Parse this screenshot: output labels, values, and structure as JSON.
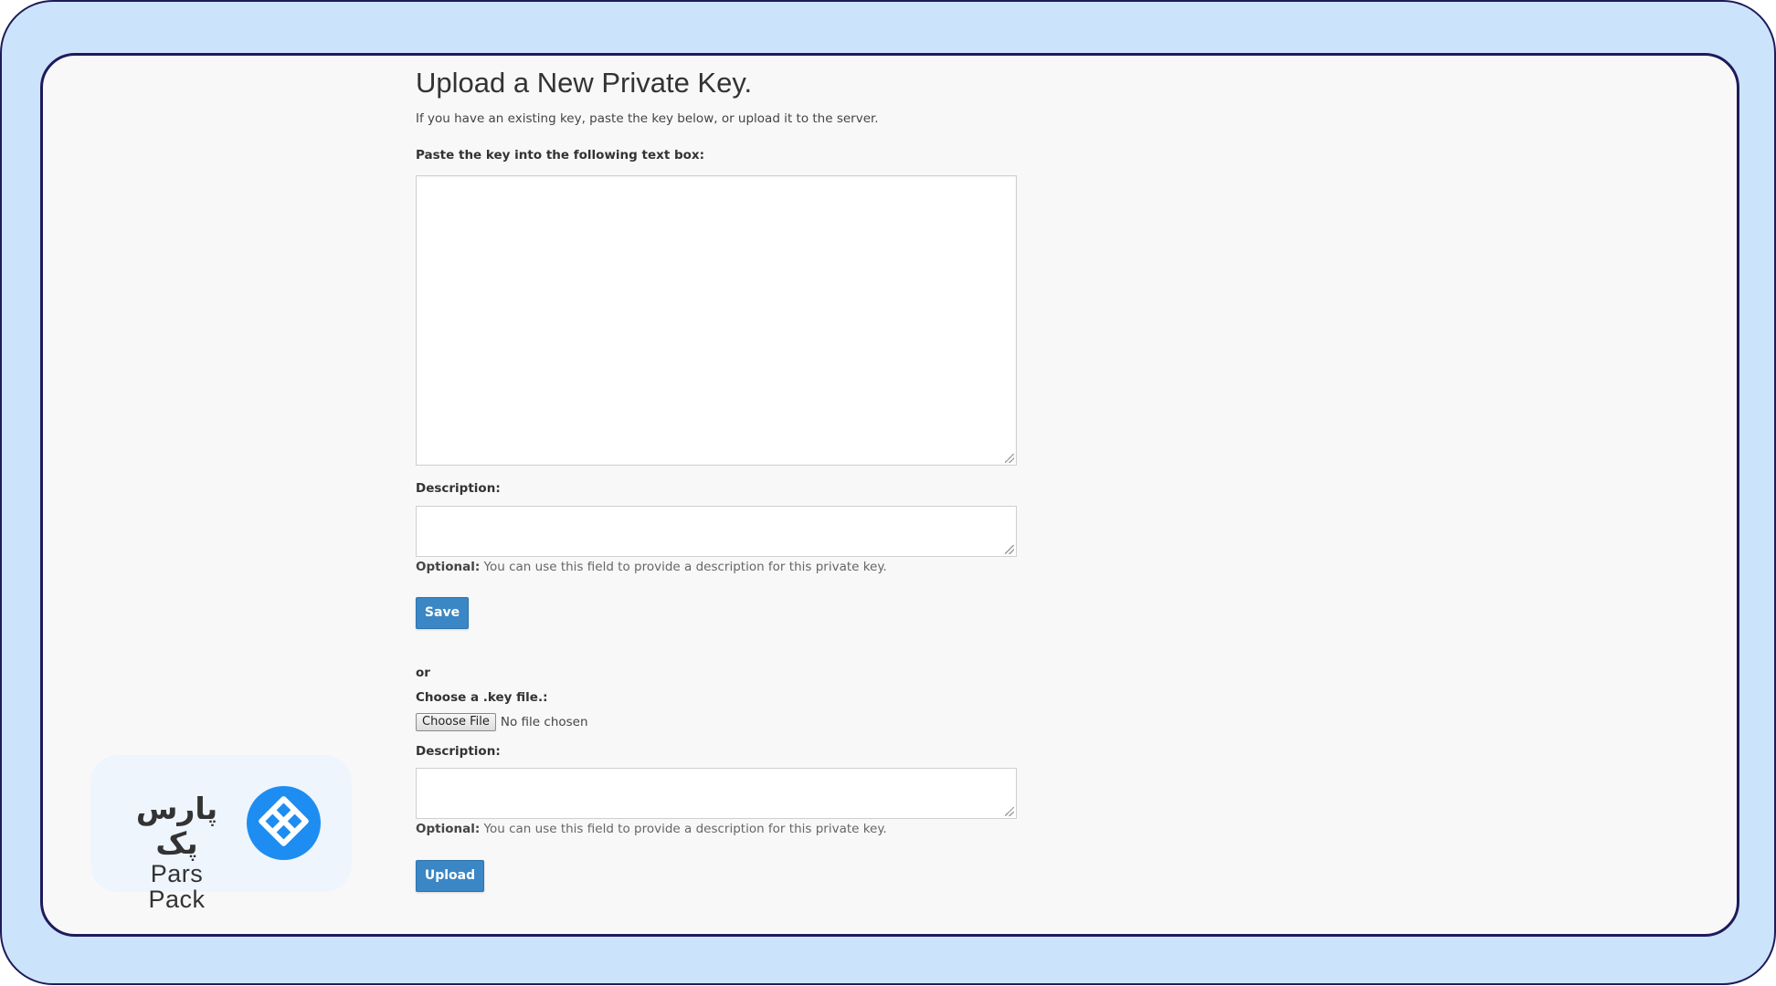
{
  "page": {
    "title": "Upload a New Private Key.",
    "subtitle": "If you have an existing key, paste the key below, or upload it to the server."
  },
  "paste_section": {
    "label": "Paste the key into the following text box:",
    "key_value": "",
    "description_label": "Description:",
    "description_value": "",
    "help_strong": "Optional:",
    "help_text": " You can use this field to provide a description for this private key.",
    "save_label": "Save"
  },
  "separator": "or",
  "upload_section": {
    "file_label": "Choose a .key file.:",
    "choose_file_label": "Choose File",
    "file_status": "No file chosen",
    "description_label": "Description:",
    "description_value": "",
    "help_strong": "Optional:",
    "help_text": " You can use this field to provide a description for this private key.",
    "upload_label": "Upload"
  },
  "brand": {
    "name_fa": "پارس پک",
    "name_en": "Pars Pack",
    "logo_icon": "diamond-logo-icon",
    "logo_color": "#1e8df2"
  },
  "colors": {
    "frame_outer": "#cbe4fb",
    "frame_border": "#1f1a5c",
    "button_primary": "#3b86c4"
  }
}
